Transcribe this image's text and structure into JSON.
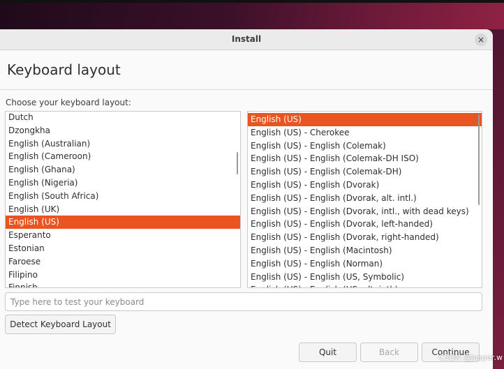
{
  "window": {
    "title": "Install",
    "close_glyph": "×"
  },
  "page": {
    "title": "Keyboard layout",
    "choose_label": "Choose your keyboard layout:"
  },
  "layouts": [
    "Dutch",
    "Dzongkha",
    "English (Australian)",
    "English (Cameroon)",
    "English (Ghana)",
    "English (Nigeria)",
    "English (South Africa)",
    "English (UK)",
    "English (US)",
    "Esperanto",
    "Estonian",
    "Faroese",
    "Filipino",
    "Finnish"
  ],
  "layouts_selected": "English (US)",
  "variants": [
    "English (US)",
    "English (US) - Cherokee",
    "English (US) - English (Colemak)",
    "English (US) - English (Colemak-DH ISO)",
    "English (US) - English (Colemak-DH)",
    "English (US) - English (Dvorak)",
    "English (US) - English (Dvorak, alt. intl.)",
    "English (US) - English (Dvorak, intl., with dead keys)",
    "English (US) - English (Dvorak, left-handed)",
    "English (US) - English (Dvorak, right-handed)",
    "English (US) - English (Macintosh)",
    "English (US) - English (Norman)",
    "English (US) - English (US, Symbolic)",
    "English (US) - English (US, alt. intl.)"
  ],
  "variants_selected": "English (US)",
  "test_input": {
    "placeholder": "Type here to test your keyboard",
    "value": ""
  },
  "buttons": {
    "detect": "Detect Keyboard Layout",
    "quit": "Quit",
    "back": "Back",
    "continue": "Continue"
  },
  "watermark": "CSDN @Jasper.w",
  "colors": {
    "accent": "#e95420"
  }
}
